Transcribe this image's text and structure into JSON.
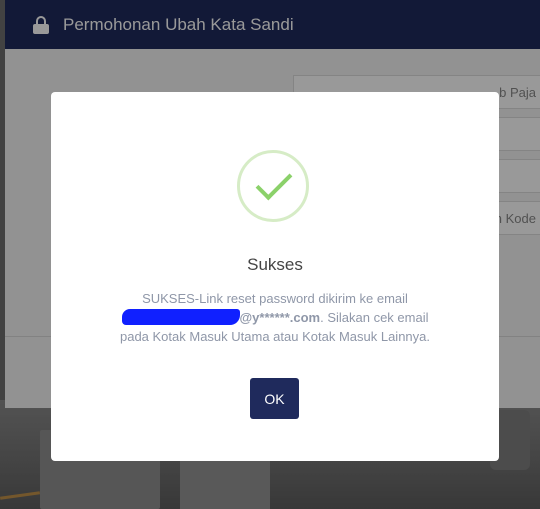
{
  "window": {
    "title": "Permohonan Ubah Kata Sandi",
    "lock_icon": "lock-icon"
  },
  "form": {
    "fields": [
      {
        "value": "b Paja"
      },
      {
        "value": ""
      },
      {
        "value": ""
      },
      {
        "value": "n Kode"
      },
      {
        "value": ""
      }
    ]
  },
  "modal": {
    "icon": "success-check-icon",
    "title": "Sukses",
    "message_line1": "SUKSES-Link reset password dikirim ke email",
    "email_visible": "@y******.com",
    "message_line2_suffix": ". Silakan cek email",
    "message_line3": "pada Kotak Masuk Utama atau Kotak Masuk Lainnya.",
    "ok_label": "OK"
  },
  "colors": {
    "header": "#1f2a5c",
    "button": "#1f2a5c",
    "success": "#8bd16a"
  }
}
